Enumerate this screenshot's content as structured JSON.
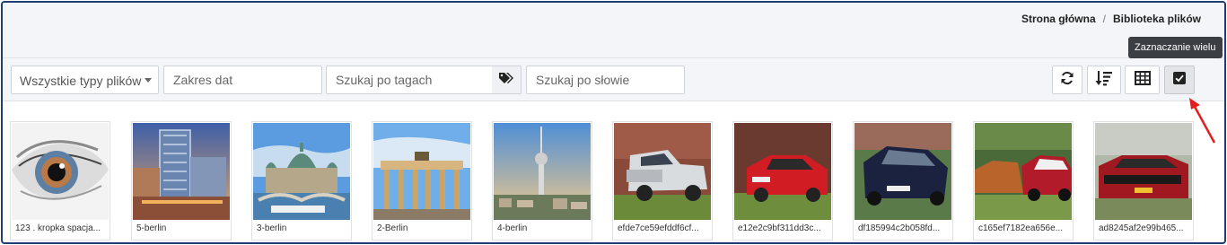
{
  "breadcrumb": {
    "home": "Strona główna",
    "separator": "/",
    "current": "Biblioteka plików"
  },
  "filters": {
    "type_select": "Wszystkie typy plików",
    "date_range_placeholder": "Zakres dat",
    "tags_placeholder": "Szukaj po tagach",
    "word_placeholder": "Szukaj po słowie"
  },
  "toolbar": {
    "tooltip": "Zaznaczanie wielu",
    "buttons": [
      "refresh-icon",
      "sort-icon",
      "grid-view-icon",
      "multi-select-icon"
    ]
  },
  "gallery": {
    "items": [
      {
        "caption": "123 . kropka spacja..."
      },
      {
        "caption": "5-berlin"
      },
      {
        "caption": "3-berlin"
      },
      {
        "caption": "2-Berlin"
      },
      {
        "caption": "4-berlin"
      },
      {
        "caption": "efde7ce59efddf6cf..."
      },
      {
        "caption": "e12e2c9bf311dd3c..."
      },
      {
        "caption": "df185994c2b058fd..."
      },
      {
        "caption": "c165ef7182ea656e..."
      },
      {
        "caption": "ad8245af2e99b465..."
      }
    ]
  },
  "colors": {
    "frame_border": "#1f3f73",
    "header_bg": "#f4f5f8",
    "arrow": "#e02020"
  }
}
